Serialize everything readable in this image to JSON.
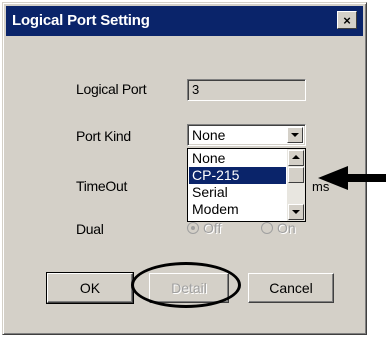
{
  "window": {
    "title": "Logical Port Setting",
    "close_glyph": "×"
  },
  "fields": {
    "logical_port_label": "Logical Port",
    "logical_port_value": "3",
    "port_kind_label": "Port Kind",
    "port_kind_value": "None",
    "timeout_label": "TimeOut",
    "timeout_units": "ms",
    "dual_label": "Dual"
  },
  "port_kind_options": [
    {
      "label": "None",
      "selected": false
    },
    {
      "label": "CP-215",
      "selected": true
    },
    {
      "label": "Serial",
      "selected": false
    },
    {
      "label": "Modem",
      "selected": false
    }
  ],
  "dual_options": {
    "off": "Off",
    "on": "On",
    "selected": "Off",
    "enabled": false
  },
  "buttons": {
    "ok": "OK",
    "detail": "Detail",
    "cancel": "Cancel"
  },
  "colors": {
    "titlebar": "#0a246a",
    "selection": "#0a246a",
    "face": "#d4d0c8"
  }
}
